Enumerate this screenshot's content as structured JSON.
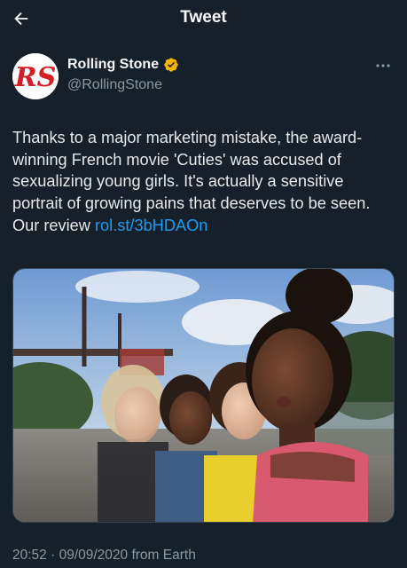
{
  "header": {
    "title": "Tweet",
    "back_icon": "arrow-left-icon"
  },
  "author": {
    "avatar_text": "RS",
    "display_name": "Rolling Stone",
    "handle": "@RollingStone",
    "verified_icon": "verified-badge-icon",
    "verified_color": "#f4b400",
    "more_icon": "more-dots-icon"
  },
  "tweet": {
    "text": "Thanks to a major marketing mistake, the award-winning French movie 'Cuties' was accused of sexualizing young girls. It's actually a sensitive portrait of growing pains that deserves to be seen. Our review ",
    "link_text": "rol.st/3bHDAOn"
  },
  "meta": {
    "time": "20:52",
    "separator": " · ",
    "date": "09/09/2020",
    "source": " from Earth"
  },
  "colors": {
    "background": "#15202b",
    "link": "#1d9bf0",
    "secondary_text": "#8b98a5",
    "brand_red": "#d32027"
  }
}
